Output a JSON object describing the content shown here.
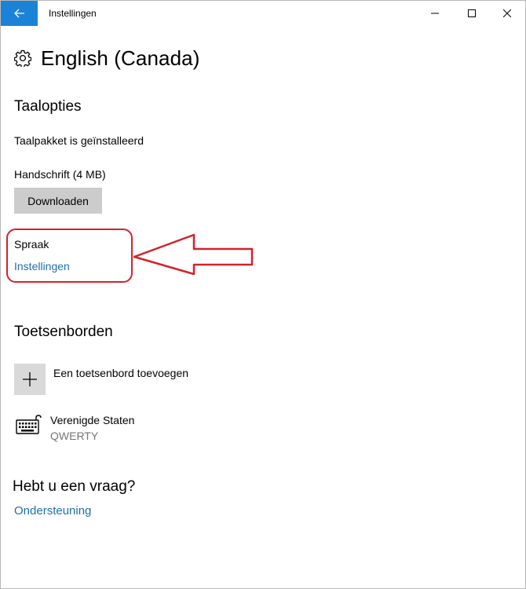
{
  "window": {
    "title": "Instellingen",
    "accent_color": "#1a83d8"
  },
  "page": {
    "title": "English (Canada)",
    "icon": "gear-icon"
  },
  "language_options": {
    "heading": "Taalopties",
    "status": "Taalpakket is geïnstalleerd",
    "handwriting_label": "Handschrift (4 MB)",
    "download_button": "Downloaden",
    "speech_label": "Spraak",
    "speech_settings_link": "Instellingen"
  },
  "annotation": {
    "color": "#d2232a"
  },
  "keyboards": {
    "heading": "Toetsenborden",
    "add_label": "Een toetsenbord toevoegen",
    "items": [
      {
        "name": "Verenigde Staten",
        "layout": "QWERTY",
        "icon": "keyboard-icon"
      }
    ]
  },
  "help": {
    "heading": "Hebt u een vraag?",
    "support_link": "Ondersteuning",
    "link_color": "#1d6fa8"
  }
}
